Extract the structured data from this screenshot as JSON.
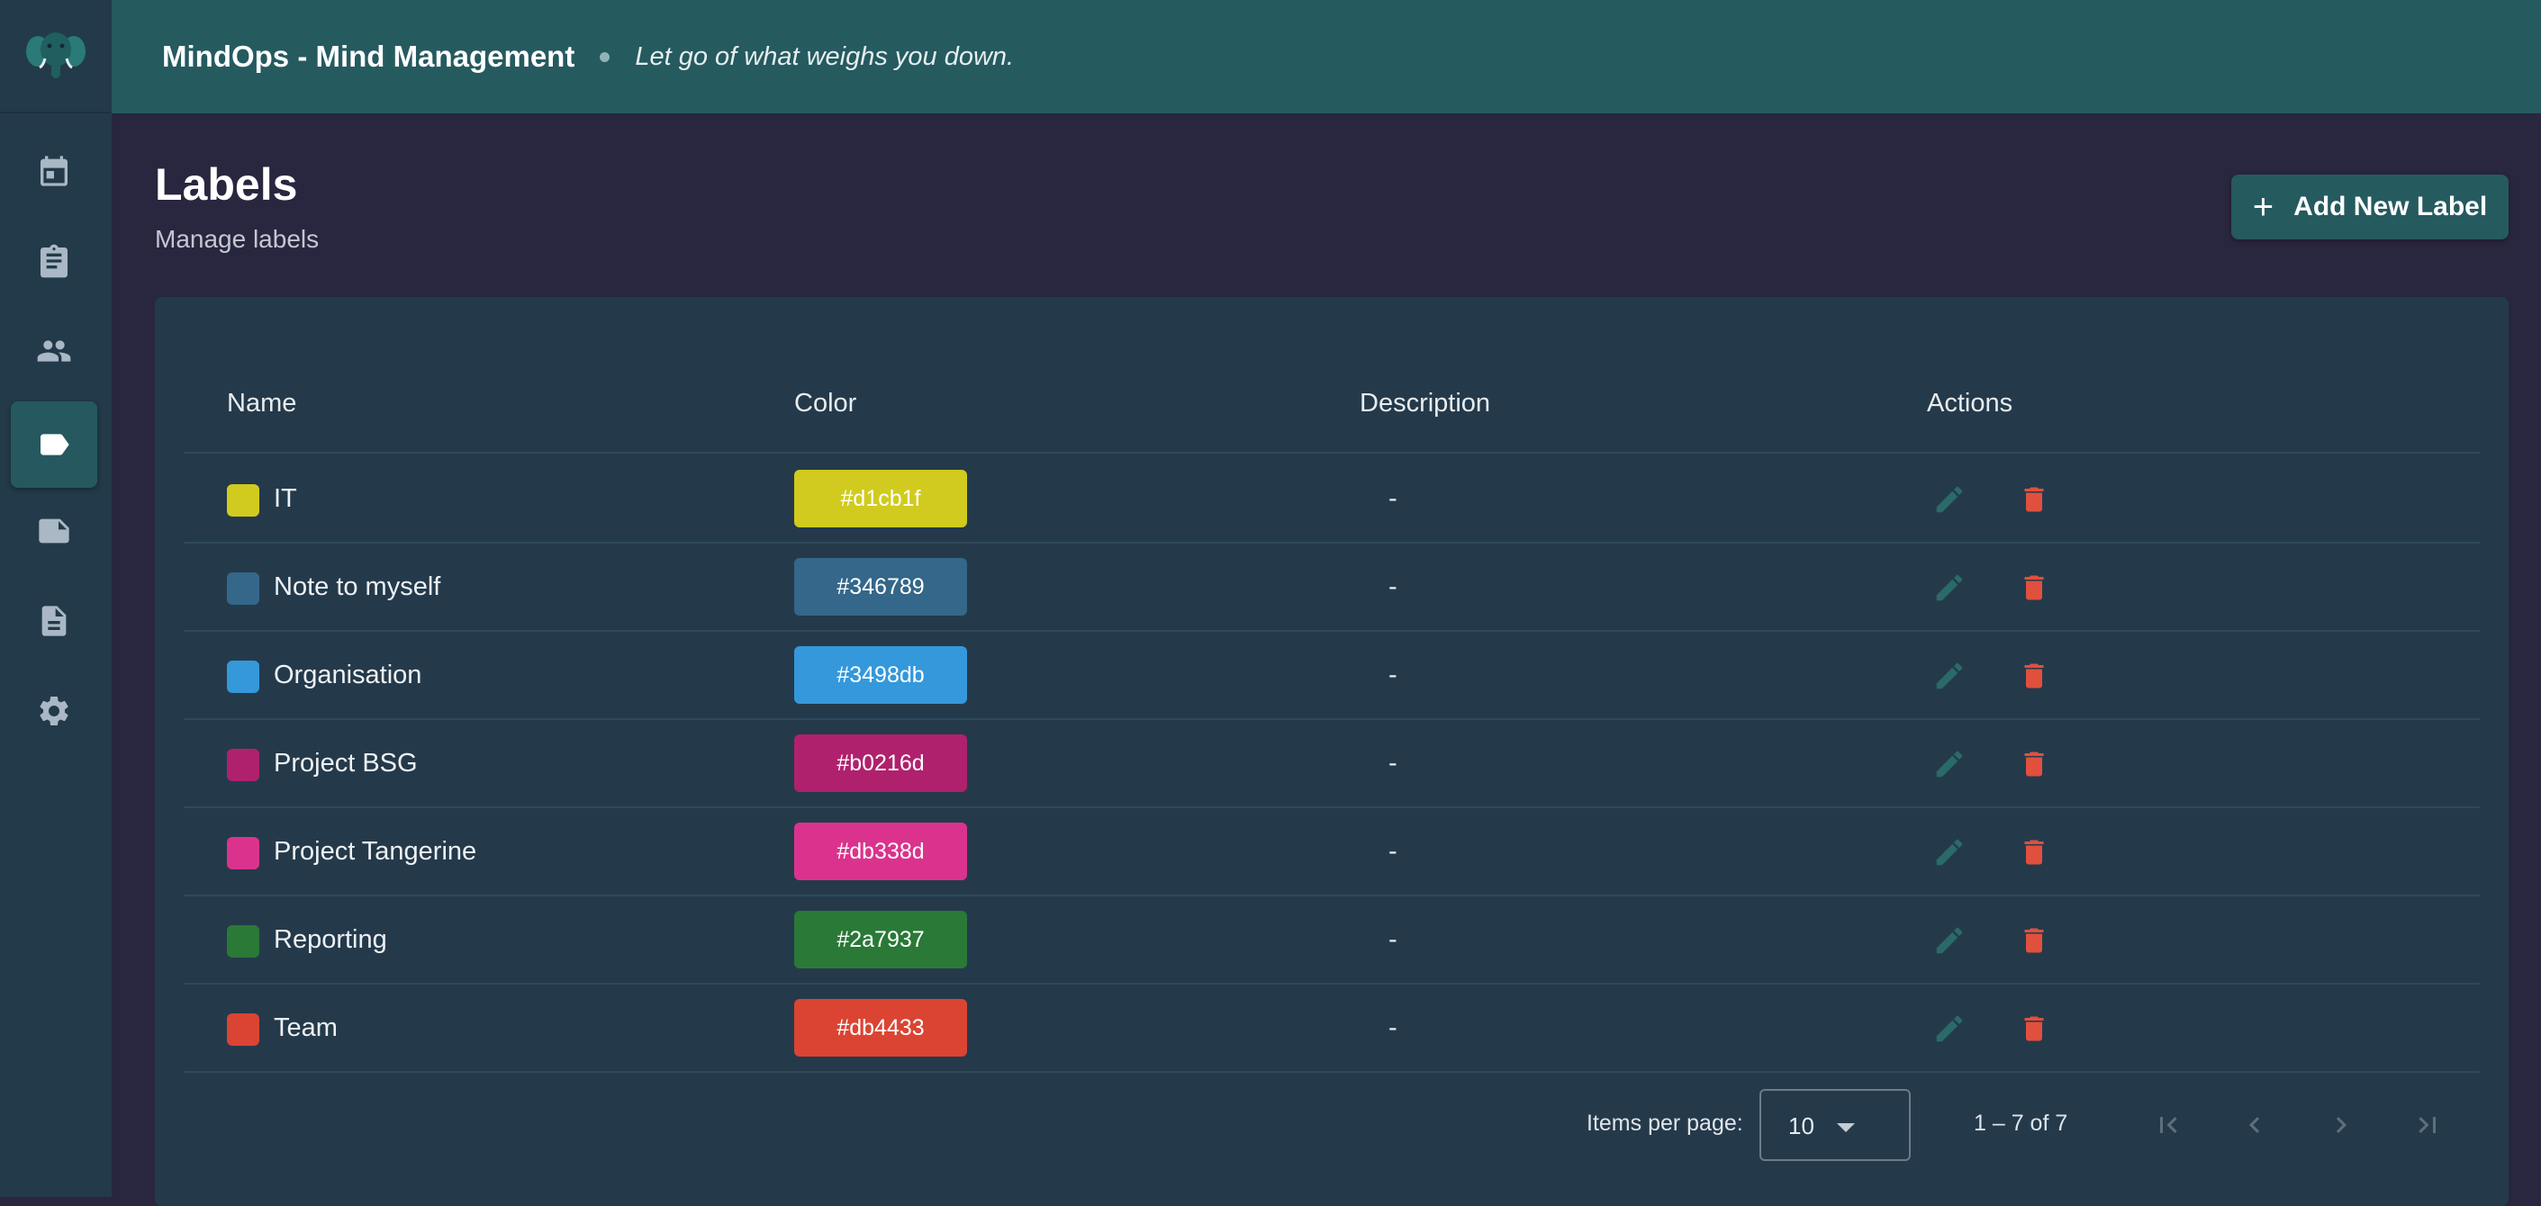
{
  "app": {
    "title": "MindOps - Mind Management",
    "tagline": "Let go of what weighs you down."
  },
  "sidebar": {
    "items": [
      {
        "name": "calendar",
        "icon": "calendar-icon",
        "active": false
      },
      {
        "name": "tasks",
        "icon": "clipboard-icon",
        "active": false
      },
      {
        "name": "people",
        "icon": "people-icon",
        "active": false
      },
      {
        "name": "labels",
        "icon": "label-icon",
        "active": true
      },
      {
        "name": "notes",
        "icon": "note-icon",
        "active": false
      },
      {
        "name": "documents",
        "icon": "document-icon",
        "active": false
      },
      {
        "name": "settings",
        "icon": "gear-icon",
        "active": false
      }
    ]
  },
  "page": {
    "title": "Labels",
    "subtitle": "Manage labels",
    "add_button_label": "Add New Label"
  },
  "table": {
    "columns": [
      "Name",
      "Color",
      "Description",
      "Actions"
    ],
    "rows": [
      {
        "name": "IT",
        "color": "#d1cb1f",
        "color_label": "#d1cb1f",
        "description": "-"
      },
      {
        "name": "Note to myself",
        "color": "#346789",
        "color_label": "#346789",
        "description": "-"
      },
      {
        "name": "Organisation",
        "color": "#3498db",
        "color_label": "#3498db",
        "description": "-"
      },
      {
        "name": "Project BSG",
        "color": "#b0216d",
        "color_label": "#b0216d",
        "description": "-"
      },
      {
        "name": "Project Tangerine",
        "color": "#db338d",
        "color_label": "#db338d",
        "description": "-"
      },
      {
        "name": "Reporting",
        "color": "#2a7937",
        "color_label": "#2a7937",
        "description": "-"
      },
      {
        "name": "Team",
        "color": "#db4433",
        "color_label": "#db4433",
        "description": "-"
      }
    ]
  },
  "paginator": {
    "items_per_page_label": "Items per page:",
    "page_size": "10",
    "range_label": "1 – 7 of 7"
  },
  "colors": {
    "accent": "#255a5f",
    "background": "#29263f",
    "card": "#243a4b",
    "sidebar": "#233a4a",
    "delete": "#e0503d"
  }
}
